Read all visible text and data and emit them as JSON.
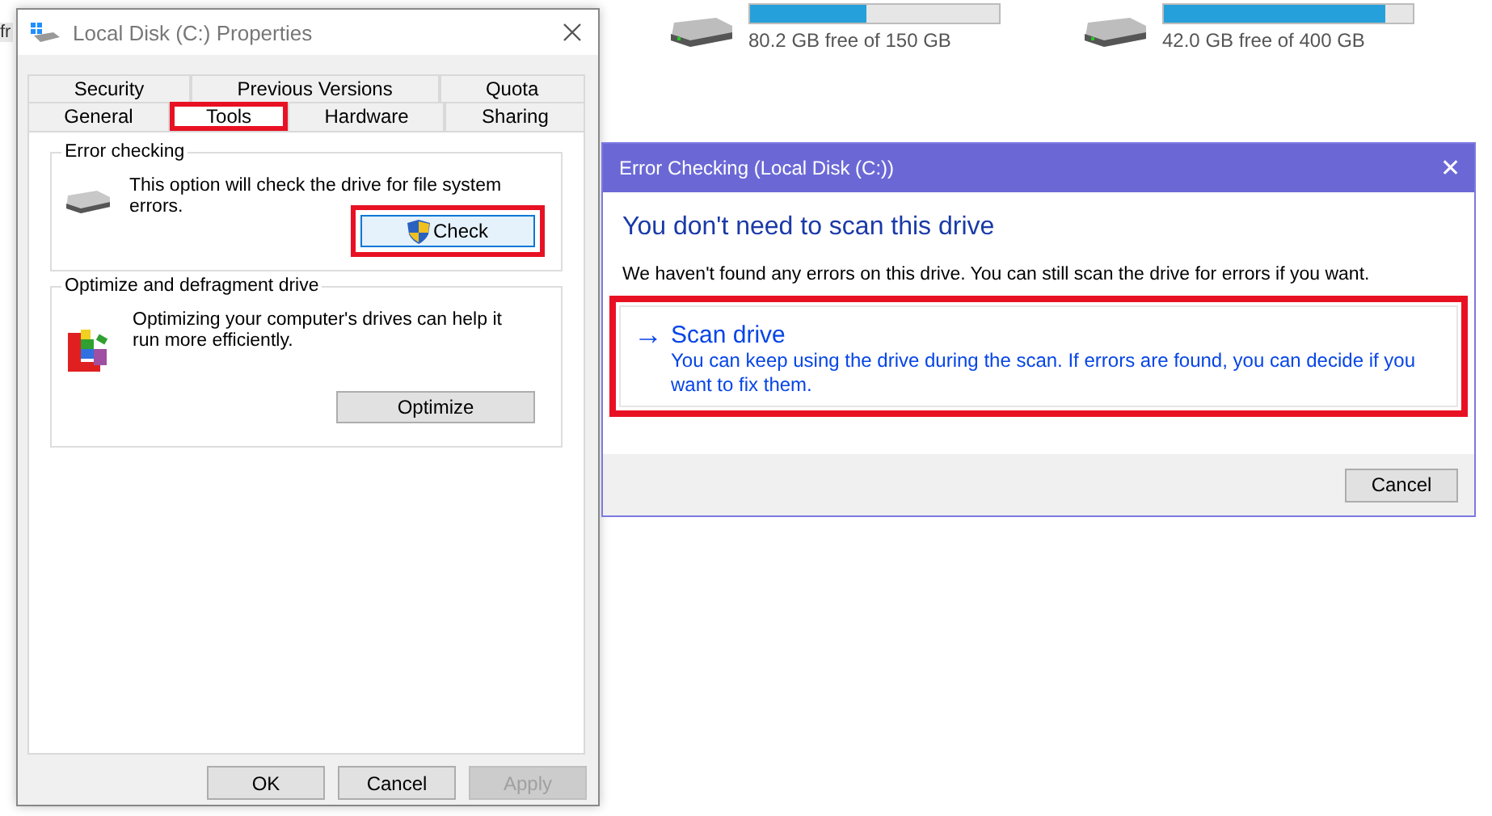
{
  "background": {
    "cut_text": "fr",
    "drives": [
      {
        "level": 0.47,
        "reading": "80.2 GB free of 150 GB"
      },
      {
        "level": 0.89,
        "reading": "42.0 GB free of 400 GB"
      }
    ]
  },
  "properties": {
    "title": "Local Disk (C:) Properties",
    "tab_rows": [
      [
        {
          "label": "Security",
          "selected": false,
          "highlighted": false
        },
        {
          "label": "Previous Versions",
          "selected": false,
          "highlighted": false
        },
        {
          "label": "Quota",
          "selected": false,
          "highlighted": false
        }
      ],
      [
        {
          "label": "General",
          "selected": false,
          "highlighted": false
        },
        {
          "label": "Tools",
          "selected": true,
          "highlighted": true
        },
        {
          "label": "Hardware",
          "selected": false,
          "highlighted": false
        },
        {
          "label": "Sharing",
          "selected": false,
          "highlighted": false
        }
      ]
    ],
    "groups": [
      {
        "kind": "check",
        "title": "Error checking",
        "text": "This option will check the drive for file system errors.",
        "button": "Check",
        "highlighted": true
      },
      {
        "kind": "optimize",
        "title": "Optimize and defragment drive",
        "text": "Optimizing your computer's drives can help it run more efficiently.",
        "button": "Optimize",
        "highlighted": false
      }
    ],
    "buttons": [
      {
        "label": "OK",
        "disabled": false
      },
      {
        "label": "Cancel",
        "disabled": false
      },
      {
        "label": "Apply",
        "disabled": true
      }
    ]
  },
  "error_dialog": {
    "title": "Error Checking (Local Disk (C:))",
    "close": "✕",
    "heading": "You don't need to scan this drive",
    "message": "We haven't found any errors on this drive. You can still scan the drive for errors if you want.",
    "option": {
      "arrow": "→",
      "title": "Scan drive",
      "text": "You can keep using the drive during the scan. If errors are found, you can decide if you want to fix them.",
      "highlighted": true
    },
    "buttons": [
      "Cancel"
    ]
  }
}
